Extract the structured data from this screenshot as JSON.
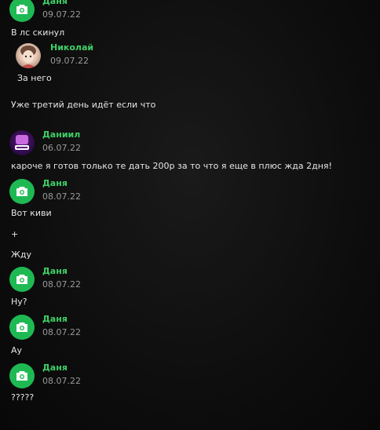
{
  "messages": [
    {
      "author": "Даня",
      "date": "09.07.22",
      "text": "В лс скинул"
    },
    {
      "author": "Николай",
      "date": "09.07.22",
      "text": "За него"
    },
    {
      "author": "",
      "date": "",
      "text": "Уже третий день идёт если что"
    },
    {
      "author": "Даниил",
      "date": "06.07.22",
      "text": "кароче я готов только те дать 200р за то что я еще в плюс жда 2дня!"
    },
    {
      "author": "Даня",
      "date": "08.07.22",
      "text": "Вот киви"
    },
    {
      "author": "",
      "date": "",
      "text": "+"
    },
    {
      "author": "",
      "date": "",
      "text": "Жду"
    },
    {
      "author": "Даня",
      "date": "08.07.22",
      "text": "Ну?"
    },
    {
      "author": "Даня",
      "date": "08.07.22",
      "text": "Ау"
    },
    {
      "author": "Даня",
      "date": "08.07.22",
      "text": "?????"
    }
  ],
  "avatars": {
    "danya": "camera-icon",
    "nikolai": "anime-avatar",
    "daniil": "stream-avatar"
  },
  "colors": {
    "name": "#3fcf66",
    "avatar_green": "#1fb954",
    "date": "#9a9a9a",
    "background": "#0d0d0d"
  }
}
